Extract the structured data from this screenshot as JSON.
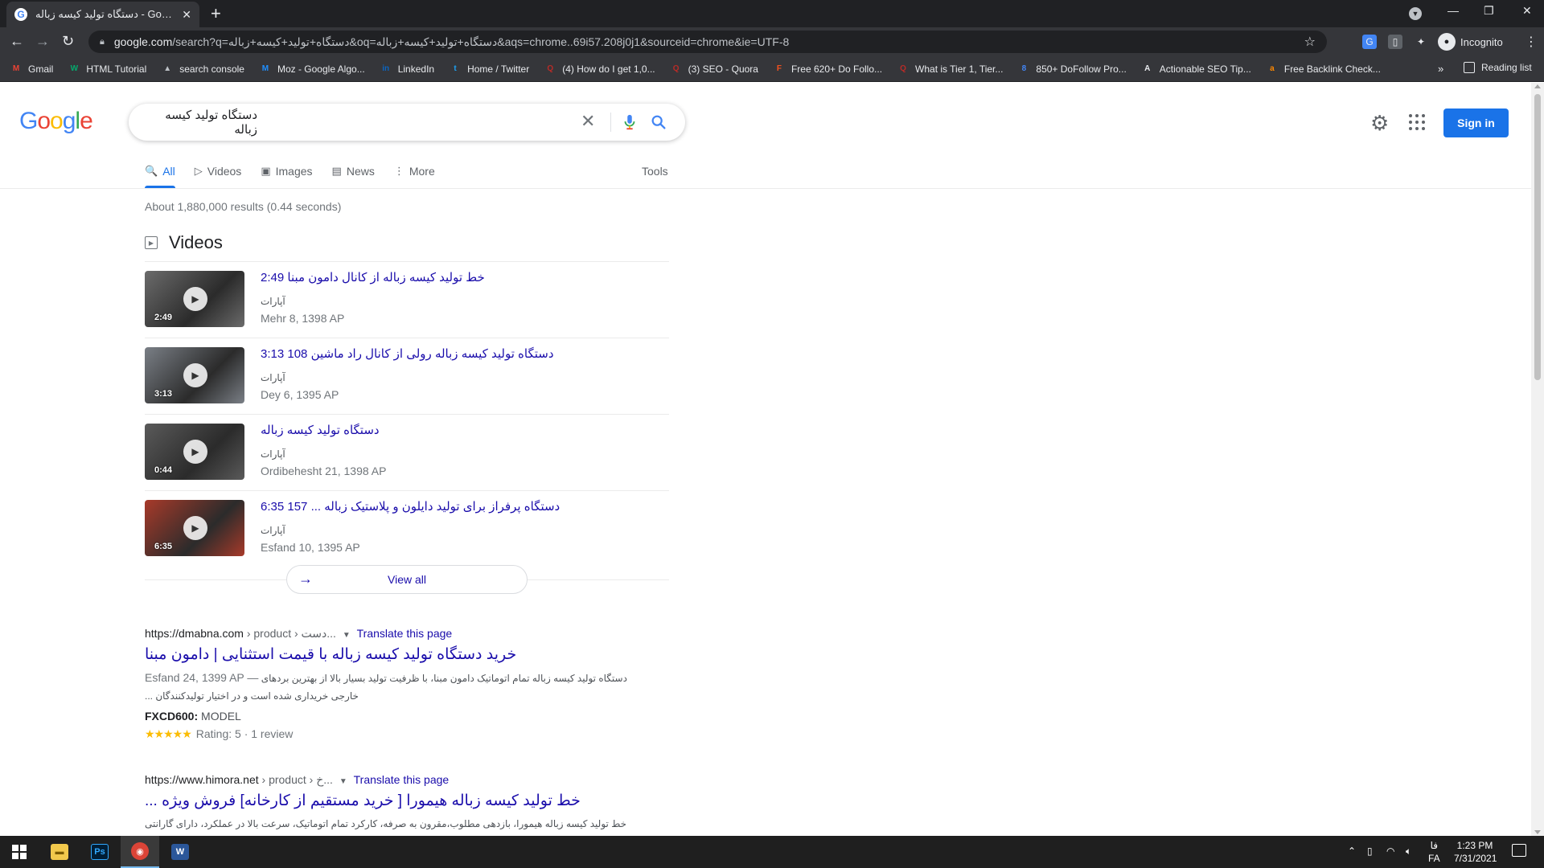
{
  "browser": {
    "tab_title": "دستگاه تولید کیسه زباله - Google Search",
    "url_host": "google.com",
    "url_rest": "/search?q=دستگاه+تولید+کیسه+زباله&oq=دستگاه+تولید+کیسه+زباله&aqs=chrome..69i57.208j0j1&sourceid=chrome&ie=UTF-8",
    "profile_label": "Incognito",
    "bookmarks": [
      {
        "label": "Gmail",
        "icon": "gmail-icon",
        "glyph": "M",
        "color": "#ea4335"
      },
      {
        "label": "HTML Tutorial",
        "icon": "w3schools-icon",
        "glyph": "W",
        "color": "#04aa6d"
      },
      {
        "label": "search console",
        "icon": "search-console-icon",
        "glyph": "▲",
        "color": "#bdc1c6"
      },
      {
        "label": "Moz - Google Algo...",
        "icon": "moz-icon",
        "glyph": "M",
        "color": "#1f8fff"
      },
      {
        "label": "LinkedIn",
        "icon": "linkedin-icon",
        "glyph": "in",
        "color": "#0a66c2"
      },
      {
        "label": "Home / Twitter",
        "icon": "twitter-icon",
        "glyph": "t",
        "color": "#1da1f2"
      },
      {
        "label": "(4) How do I get 1,0...",
        "icon": "quora-icon",
        "glyph": "Q",
        "color": "#b92b27"
      },
      {
        "label": "(3) SEO - Quora",
        "icon": "quora-icon",
        "glyph": "Q",
        "color": "#b92b27"
      },
      {
        "label": "Free 620+ Do Follo...",
        "icon": "site-icon",
        "glyph": "F",
        "color": "#f4511e"
      },
      {
        "label": "What is Tier 1, Tier...",
        "icon": "quora-icon",
        "glyph": "Q",
        "color": "#b92b27"
      },
      {
        "label": "850+ DoFollow Pro...",
        "icon": "site-icon",
        "glyph": "8",
        "color": "#4285f4"
      },
      {
        "label": "Actionable SEO Tip...",
        "icon": "site-icon",
        "glyph": "A",
        "color": "#e8eaed"
      },
      {
        "label": "Free Backlink Check...",
        "icon": "ahrefs-icon",
        "glyph": "a",
        "color": "#ff8800"
      }
    ],
    "reading_list": "Reading list",
    "bookmarks_more": "»"
  },
  "search": {
    "query": "دستگاه تولید کیسه زباله",
    "sign_in": "Sign in",
    "tabs": [
      {
        "label": "All",
        "icon": "🔍"
      },
      {
        "label": "Videos",
        "icon": "▷"
      },
      {
        "label": "Images",
        "icon": "▣"
      },
      {
        "label": "News",
        "icon": "▤"
      },
      {
        "label": "More",
        "icon": "⋮"
      }
    ],
    "tools": "Tools",
    "stats": "About 1,880,000 results (0.44 seconds)"
  },
  "videos": {
    "heading": "Videos",
    "items": [
      {
        "title": "خط تولید کیسه زباله از کانال دامون مبنا 2:49",
        "source": "آپارات",
        "date": "Mehr 8, 1398 AP",
        "duration": "2:49",
        "thumb_color": "#6b6b6b"
      },
      {
        "title": "دستگاه تولید کیسه زباله رولی از کانال راد ماشین 108 3:13",
        "source": "آپارات",
        "date": "Dey 6, 1395 AP",
        "duration": "3:13",
        "thumb_color": "#7a7f86"
      },
      {
        "title": "دستگاه تولید کیسه زباله",
        "source": "آپارات",
        "date": "Ordibehesht 21, 1398 AP",
        "duration": "0:44",
        "thumb_color": "#5a5a5a"
      },
      {
        "title": "دستگاه پرفراز برای تولید دایلون و پلاستیک زباله ... 157 6:35",
        "source": "آپارات",
        "date": "Esfand 10, 1395 AP",
        "duration": "6:35",
        "thumb_color": "#a83a2a"
      }
    ],
    "view_all": "View all"
  },
  "results": [
    {
      "cite_domain": "https://dmabna.com",
      "cite_path": "› product › دست...",
      "translate": "Translate this page",
      "title": "خرید دستگاه تولید کیسه زباله با قیمت استثنایی | دامون مبنا",
      "date": "Esfand 24, 1399 AP —",
      "snippet": "دستگاه تولید کیسه زباله تمام اتوماتیک دامون مبنا، با ظرفیت تولید بسیار بالا از بهترین بردهای خارجی خریداری شده است و در اختیار تولیدکنندگان ...",
      "model_code": "FXCD600:",
      "model_label": "MODEL",
      "stars": "★★★★★",
      "rating": "Rating: 5 · 1 review"
    },
    {
      "cite_domain": "https://www.himora.net",
      "cite_path": "› product › خ...",
      "translate": "Translate this page",
      "title": "خط تولید کیسه زباله هیمورا [ خرید مستقیم از کارخانه] فروش ویژه ...",
      "snippet": "خط تولید کیسه زباله هیمورا، بازدهی مطلوب،مقرون به صرفه، کارکرد تمام اتوماتیک، سرعت بالا در عملکرد، دارای گارانتی و"
    }
  ],
  "taskbar": {
    "time": "1:23 PM",
    "date": "7/31/2021",
    "lang_top": "فا",
    "lang_bottom": "FA"
  }
}
